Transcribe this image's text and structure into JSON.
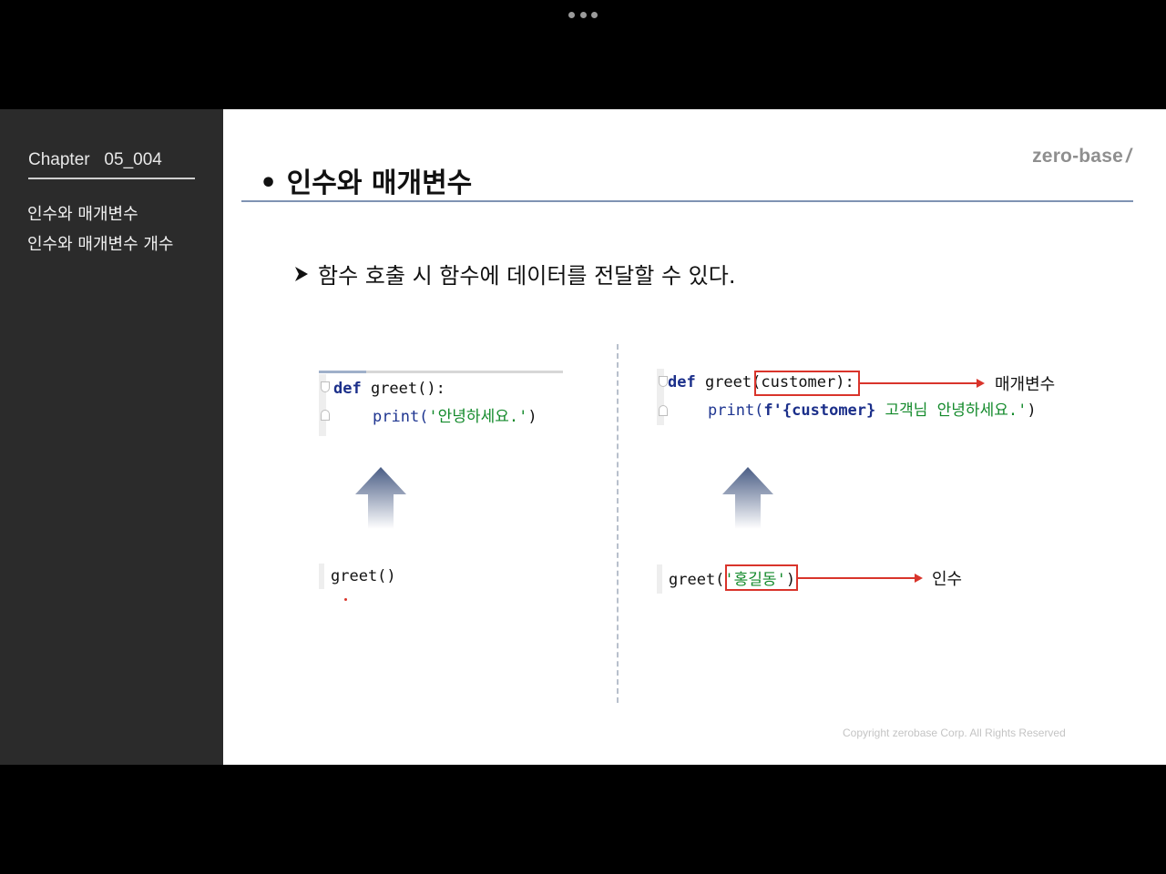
{
  "window": {
    "more_icon": "more-horizontal-icon"
  },
  "sidebar": {
    "chapter": "Chapter   05_004",
    "items": [
      {
        "label": "인수와 매개변수"
      },
      {
        "label": "인수와 매개변수 개수"
      }
    ]
  },
  "slide": {
    "logo_text": "zero-base",
    "logo_slash": "/",
    "title": "• 인수와 매개변수",
    "bullet_icon": "arrowhead-bullet-icon",
    "bullet_text": "함수 호출 시 함수에 데이터를 전달할 수 있다.",
    "left_example": {
      "def_keyword": "def",
      "def_rest": " greet():",
      "print_fn": "print(",
      "print_str": "'안녕하세요.'",
      "print_close": ")",
      "call": "greet()"
    },
    "right_example": {
      "def_keyword": "def",
      "def_name": " greet",
      "def_params": "(customer)",
      "def_colon": ":",
      "print_fn": "print(",
      "print_fprefix": "f'",
      "print_expr": "{customer}",
      "print_str": " 고객님 안녕하세요.'",
      "print_close": ")",
      "call_name": "greet(",
      "call_arg": "'홍길동'",
      "call_close": ")",
      "param_label": "매개변수",
      "arg_label": "인수"
    },
    "copyright": "Copyright zerobase Corp. All Rights Reserved"
  },
  "colors": {
    "sidebar_bg": "#2b2b2b",
    "keyword": "#1b2f8a",
    "string": "#138a2b",
    "highlight": "#d9342b",
    "title_rule": "#7f93b3"
  }
}
